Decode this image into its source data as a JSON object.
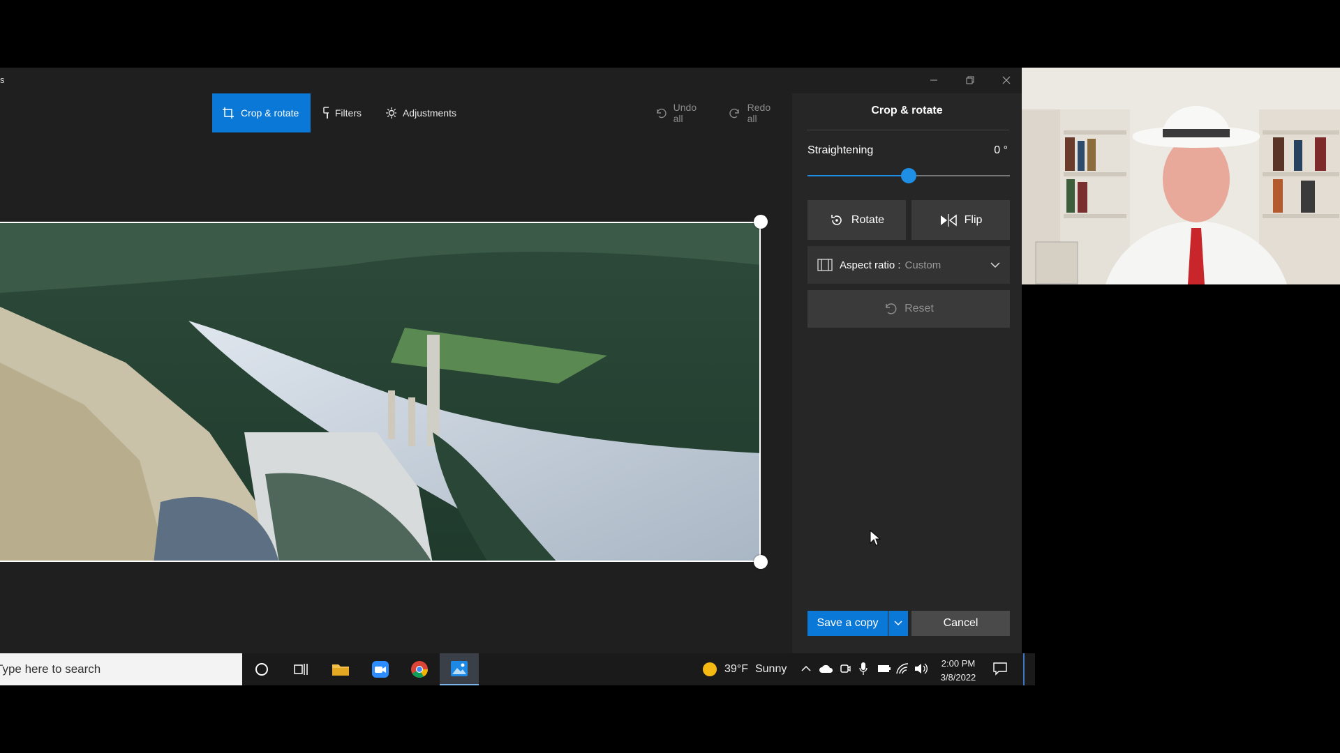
{
  "window": {
    "title_fragment": "s"
  },
  "toolbar": {
    "crop_rotate": "Crop & rotate",
    "filters": "Filters",
    "adjustments": "Adjustments",
    "undo_all": "Undo all",
    "redo_all": "Redo all"
  },
  "panel": {
    "title": "Crop & rotate",
    "straightening_label": "Straightening",
    "straightening_value": "0 °",
    "straightening_level": 0.5,
    "rotate": "Rotate",
    "flip": "Flip",
    "aspect_ratio_label": "Aspect ratio :",
    "aspect_ratio_value": "Custom",
    "reset": "Reset",
    "save_copy": "Save a copy",
    "cancel": "Cancel"
  },
  "taskbar": {
    "search_placeholder": "Type here to search",
    "weather_temp": "39°F",
    "weather_condition": "Sunny",
    "time": "2:00 PM",
    "date": "3/8/2022"
  },
  "colors": {
    "accent": "#0a78d7",
    "panel_bg": "#262626",
    "app_bg": "#1f1f1f"
  }
}
